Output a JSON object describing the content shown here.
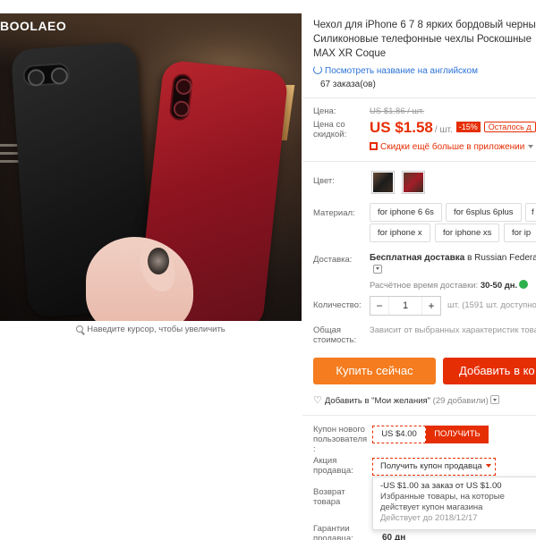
{
  "photo": {
    "brand": "BOOLAEO",
    "zoom_hint": "Наведите курсор, чтобы увеличить"
  },
  "product": {
    "title_lines": [
      "Чехол для iPhone 6 7 8 ярких бордовый черны",
      "Силиконовые телефонные чехлы Роскошные",
      "MAX XR Coque"
    ],
    "translate_link": "Посмотреть название на английском",
    "orders": "67 заказа(ов)"
  },
  "pricing": {
    "price_label": "Цена:",
    "old_price": "US $1.86 / шт.",
    "discount_label": "Цена со скидкой:",
    "price": "US $1.58",
    "unit": "/ шт.",
    "discount": "-15%",
    "remaining": "Осталось д",
    "app_deal": "Скидки ещё больше в приложении"
  },
  "options": {
    "color_label": "Цвет:",
    "material_label": "Материал:",
    "materials": [
      "for iphone 6 6s",
      "for 6splus 6plus",
      "f",
      "for iphone x",
      "for iphone xs",
      "for ip"
    ]
  },
  "shipping": {
    "label": "Доставка:",
    "main": "Бесплатная доставка",
    "region": "в Russian Federatio",
    "time_label": "Расчётное время доставки:",
    "time_value": "30-50 дн."
  },
  "quantity": {
    "label": "Количество:",
    "value": "1",
    "minus": "−",
    "plus": "+",
    "stock": "шт. (1591 шт. доступно)"
  },
  "total": {
    "label": "Общая стоимость:",
    "note": "Зависит от выбранных характеристик това"
  },
  "actions": {
    "buy_now": "Купить сейчас",
    "add_to_cart": "Добавить в ко",
    "wishlist": "Добавить в \"Мои желания\"",
    "wishlist_count": "(29 добавили)"
  },
  "coupons": {
    "new_user_label": "Купон нового пользователя :",
    "new_user_amount": "US $4.00",
    "get_button": "ПОЛУЧИТЬ",
    "seller_promo_label": "Акция продавца:",
    "seller_coupon_button": "Получить купон продавца",
    "return_label": "Возврат товара",
    "guarantee_label": "Гарантии продавца:",
    "guarantee_value": "60 дн",
    "popup": {
      "line1": "-US $1.00 за заказ от US $1.00",
      "line2": "Избранные товары, на которые",
      "line3": "действует купон магазина",
      "line4": "Действует до 2018/12/17"
    }
  }
}
